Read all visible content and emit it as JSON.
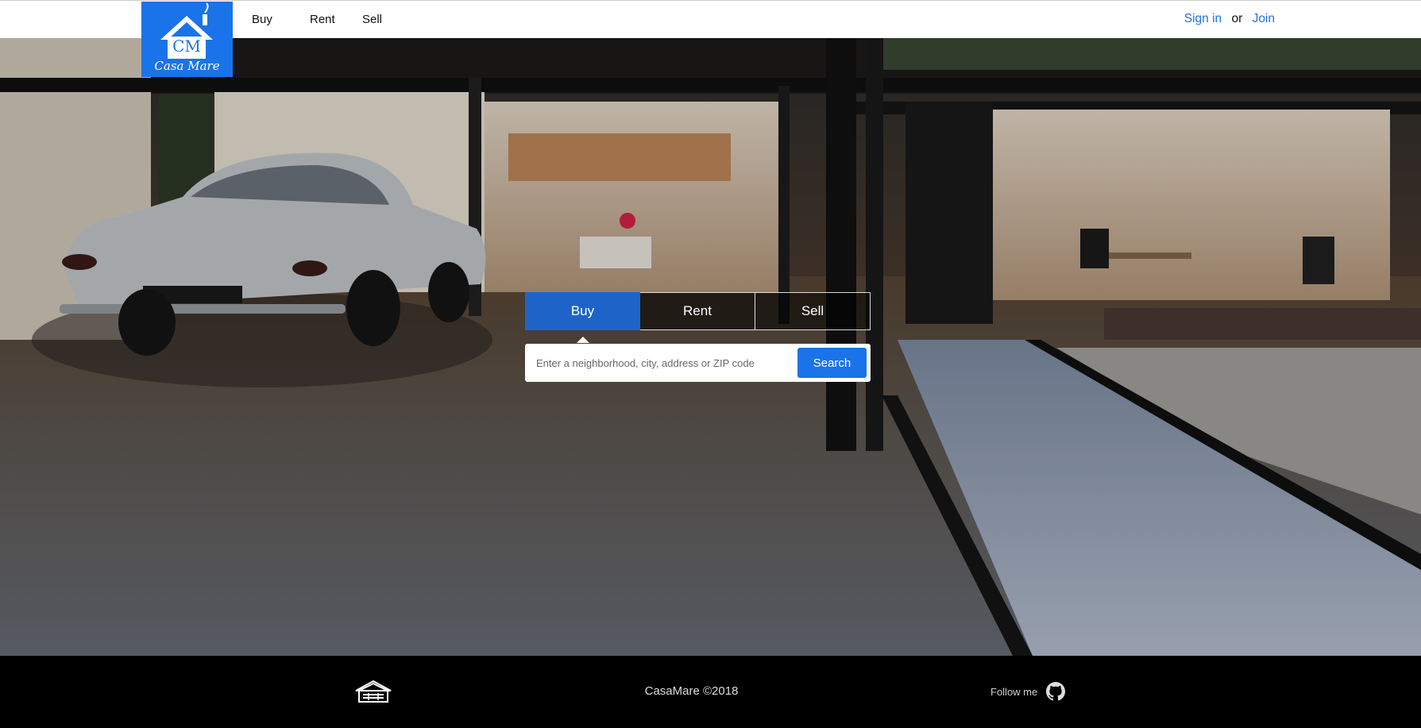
{
  "header": {
    "logo": {
      "initials": "CM",
      "name": "Casa Mare"
    },
    "nav": [
      "Buy",
      "Rent",
      "Sell"
    ],
    "auth": {
      "sign_in": "Sign in",
      "or": "or",
      "join": "Join"
    }
  },
  "hero": {
    "tabs": [
      {
        "label": "Buy",
        "active": true
      },
      {
        "label": "Rent",
        "active": false
      },
      {
        "label": "Sell",
        "active": false
      }
    ],
    "search": {
      "placeholder": "Enter a neighborhood, city, address or ZIP code",
      "value": "",
      "button": "Search"
    }
  },
  "footer": {
    "copyright": "CasaMare ©2018",
    "follow": "Follow me",
    "icons": [
      "house-icon",
      "github-icon"
    ]
  },
  "colors": {
    "accent": "#1a73e8",
    "tab_active": "#1e64c8",
    "footer_bg": "#000000",
    "header_bg": "#ffffff"
  }
}
